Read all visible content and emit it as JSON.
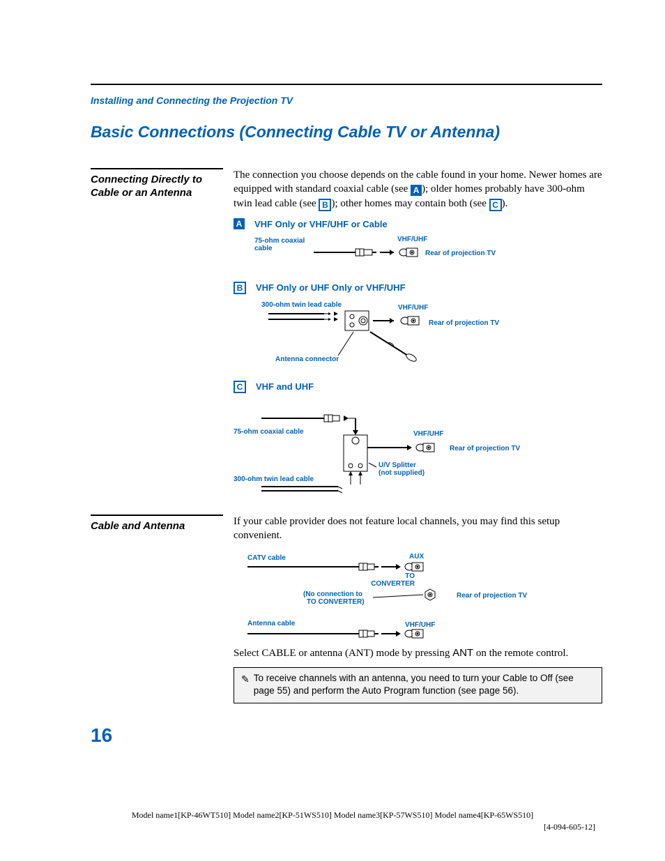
{
  "header": {
    "section": "Installing and Connecting the Projection TV"
  },
  "title": "Basic Connections (Connecting Cable TV or Antenna)",
  "section1": {
    "side_title": "Connecting Directly to Cable or an Antenna",
    "intro_pre": "The connection you choose depends on the cable found in your home. Newer homes are equipped with standard coaxial cable (see ",
    "intro_mid1": "); older homes probably have 300-ohm twin lead cable (see ",
    "intro_mid2": "); other homes may contain both (see ",
    "intro_end": ").",
    "tagA": "A",
    "tagB": "B",
    "tagC": "C",
    "diagA": {
      "title": "VHF Only or VHF/UHF or Cable",
      "lbl_coax": "75-ohm coaxial\ncable",
      "lbl_vhfuhf": "VHF/UHF",
      "lbl_rear": "Rear of projection TV"
    },
    "diagB": {
      "title": "VHF Only or UHF Only or VHF/UHF",
      "lbl_twin": "300-ohm twin lead cable",
      "lbl_vhfuhf": "VHF/UHF",
      "lbl_rear": "Rear of projection TV",
      "lbl_connector": "Antenna connector"
    },
    "diagC": {
      "title": "VHF and UHF",
      "lbl_coax": "75-ohm coaxial cable",
      "lbl_twin": "300-ohm twin lead cable",
      "lbl_vhfuhf": "VHF/UHF",
      "lbl_rear": "Rear of projection TV",
      "lbl_splitter": "U/V Splitter\n(not supplied)"
    }
  },
  "section2": {
    "side_title": "Cable and Antenna",
    "intro": "If your cable provider does not feature local channels, you may find this setup convenient.",
    "diag": {
      "lbl_catv": "CATV cable",
      "lbl_aux": "AUX",
      "lbl_toconv": "TO\nCONVERTER",
      "lbl_noconn": "(No connection to\nTO CONVERTER)",
      "lbl_rear": "Rear of projection TV",
      "lbl_ant": "Antenna cable",
      "lbl_vhfuhf": "VHF/UHF"
    },
    "outro_pre": "Select CABLE or antenna (ANT) mode by pressing ",
    "outro_ant": "ANT",
    "outro_post": " on the remote control.",
    "note": "To receive channels with an antenna, you need to turn your Cable to Off (see page 55) and perform the Auto Program function (see page 56)."
  },
  "page_number": "16",
  "footer": {
    "line1": "Model name1[KP-46WT510]  Model name2[KP-51WS510]  Model name3[KP-57WS510]  Model name4[KP-65WS510]",
    "line2": "[4-094-605-12]"
  }
}
